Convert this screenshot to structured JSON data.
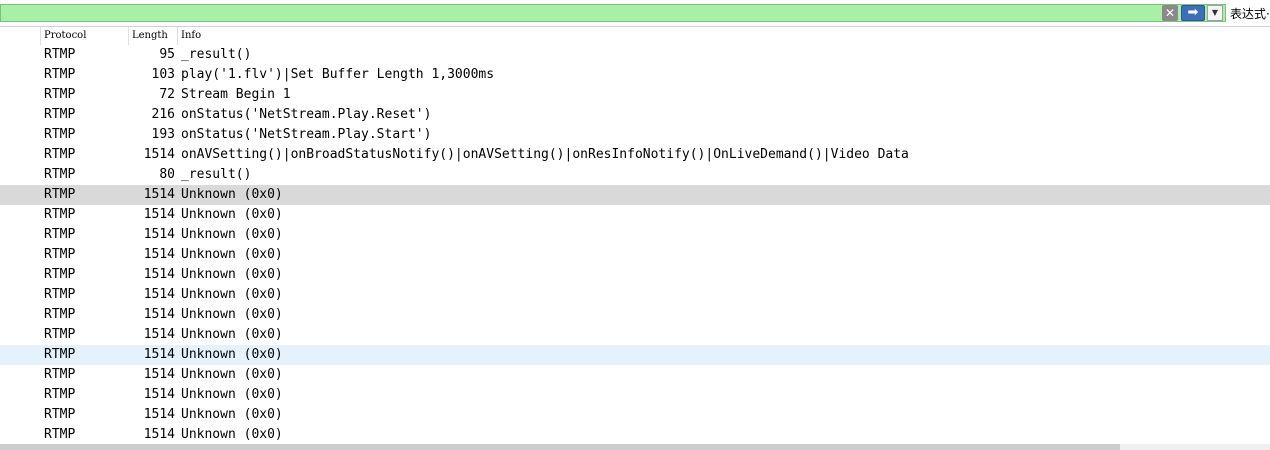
{
  "filter": {
    "value": "",
    "clear_icon": "✕",
    "apply_icon": "➡",
    "dropdown_icon": "▼",
    "expression_label": "表达式·"
  },
  "columns": [
    "Protocol",
    "Length",
    "Info"
  ],
  "rows": [
    {
      "protocol": "RTMP",
      "length": "95",
      "info": "_result()"
    },
    {
      "protocol": "RTMP",
      "length": "103",
      "info": "play('1.flv')|Set Buffer Length 1,3000ms"
    },
    {
      "protocol": "RTMP",
      "length": "72",
      "info": "Stream Begin 1"
    },
    {
      "protocol": "RTMP",
      "length": "216",
      "info": "onStatus('NetStream.Play.Reset')"
    },
    {
      "protocol": "RTMP",
      "length": "193",
      "info": "onStatus('NetStream.Play.Start')"
    },
    {
      "protocol": "RTMP",
      "length": "1514",
      "info": "onAVSetting()|onBroadStatusNotify()|onAVSetting()|onResInfoNotify()|OnLiveDemand()|Video Data"
    },
    {
      "protocol": "RTMP",
      "length": "80",
      "info": "_result()"
    },
    {
      "protocol": "RTMP",
      "length": "1514",
      "info": "Unknown (0x0)"
    },
    {
      "protocol": "RTMP",
      "length": "1514",
      "info": "Unknown (0x0)"
    },
    {
      "protocol": "RTMP",
      "length": "1514",
      "info": "Unknown (0x0)"
    },
    {
      "protocol": "RTMP",
      "length": "1514",
      "info": "Unknown (0x0)"
    },
    {
      "protocol": "RTMP",
      "length": "1514",
      "info": "Unknown (0x0)"
    },
    {
      "protocol": "RTMP",
      "length": "1514",
      "info": "Unknown (0x0)"
    },
    {
      "protocol": "RTMP",
      "length": "1514",
      "info": "Unknown (0x0)"
    },
    {
      "protocol": "RTMP",
      "length": "1514",
      "info": "Unknown (0x0)"
    },
    {
      "protocol": "RTMP",
      "length": "1514",
      "info": "Unknown (0x0)"
    },
    {
      "protocol": "RTMP",
      "length": "1514",
      "info": "Unknown (0x0)"
    },
    {
      "protocol": "RTMP",
      "length": "1514",
      "info": "Unknown (0x0)"
    },
    {
      "protocol": "RTMP",
      "length": "1514",
      "info": "Unknown (0x0)"
    },
    {
      "protocol": "RTMP",
      "length": "1514",
      "info": "Unknown (0x0)"
    }
  ],
  "selected_row": 7,
  "hover_row": 15,
  "colors": {
    "filter_bg": "#a8f0a8",
    "selected_row": "#d9d9d9",
    "hover_row": "#e5f1fb",
    "apply_button": "#3d6fb8"
  }
}
